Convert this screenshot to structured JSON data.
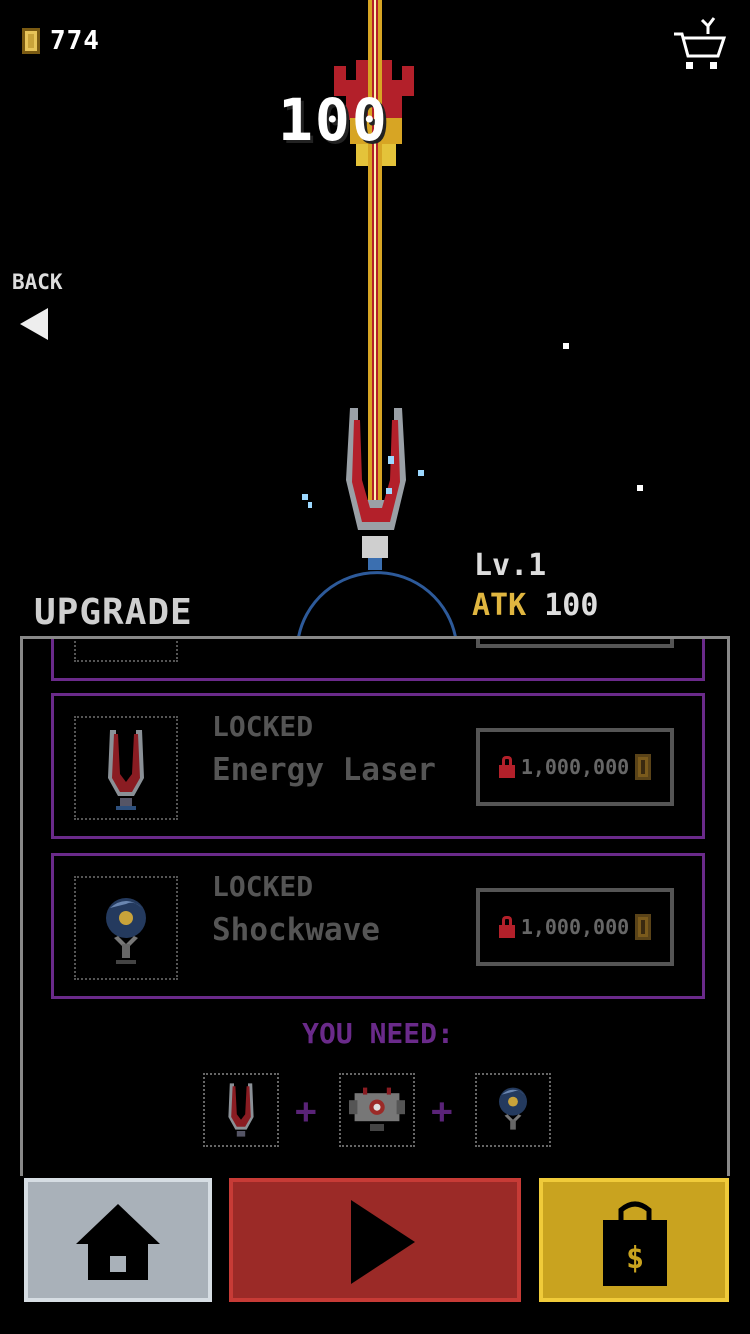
{
  "header": {
    "coins": "774",
    "score": "100"
  },
  "nav": {
    "back_label": "BACK"
  },
  "weapon": {
    "level": "Lv.1",
    "atk_label": "ATK",
    "atk_value": "100"
  },
  "upgrade": {
    "title": "UPGRADE",
    "items": [
      {
        "status": "LOCKED",
        "name": "Energy Laser",
        "price": "1,000,000",
        "icon": "energy-laser-icon"
      },
      {
        "status": "LOCKED",
        "name": "Shockwave",
        "price": "1,000,000",
        "icon": "shockwave-icon"
      }
    ],
    "you_need_label": "YOU NEED:",
    "requirements": [
      "energy-laser-icon",
      "drone-icon",
      "shockwave-icon"
    ]
  },
  "buttons": {
    "home_icon": "home-icon",
    "play_icon": "play-icon",
    "shop_icon": "shop-bag-icon"
  },
  "colors": {
    "coin": "#c9a33a",
    "atk": "#e0b640",
    "locked_border": "#6a2a8a",
    "home": "#a9b1b9",
    "play": "#9b2a27",
    "shop": "#c9a31f"
  }
}
